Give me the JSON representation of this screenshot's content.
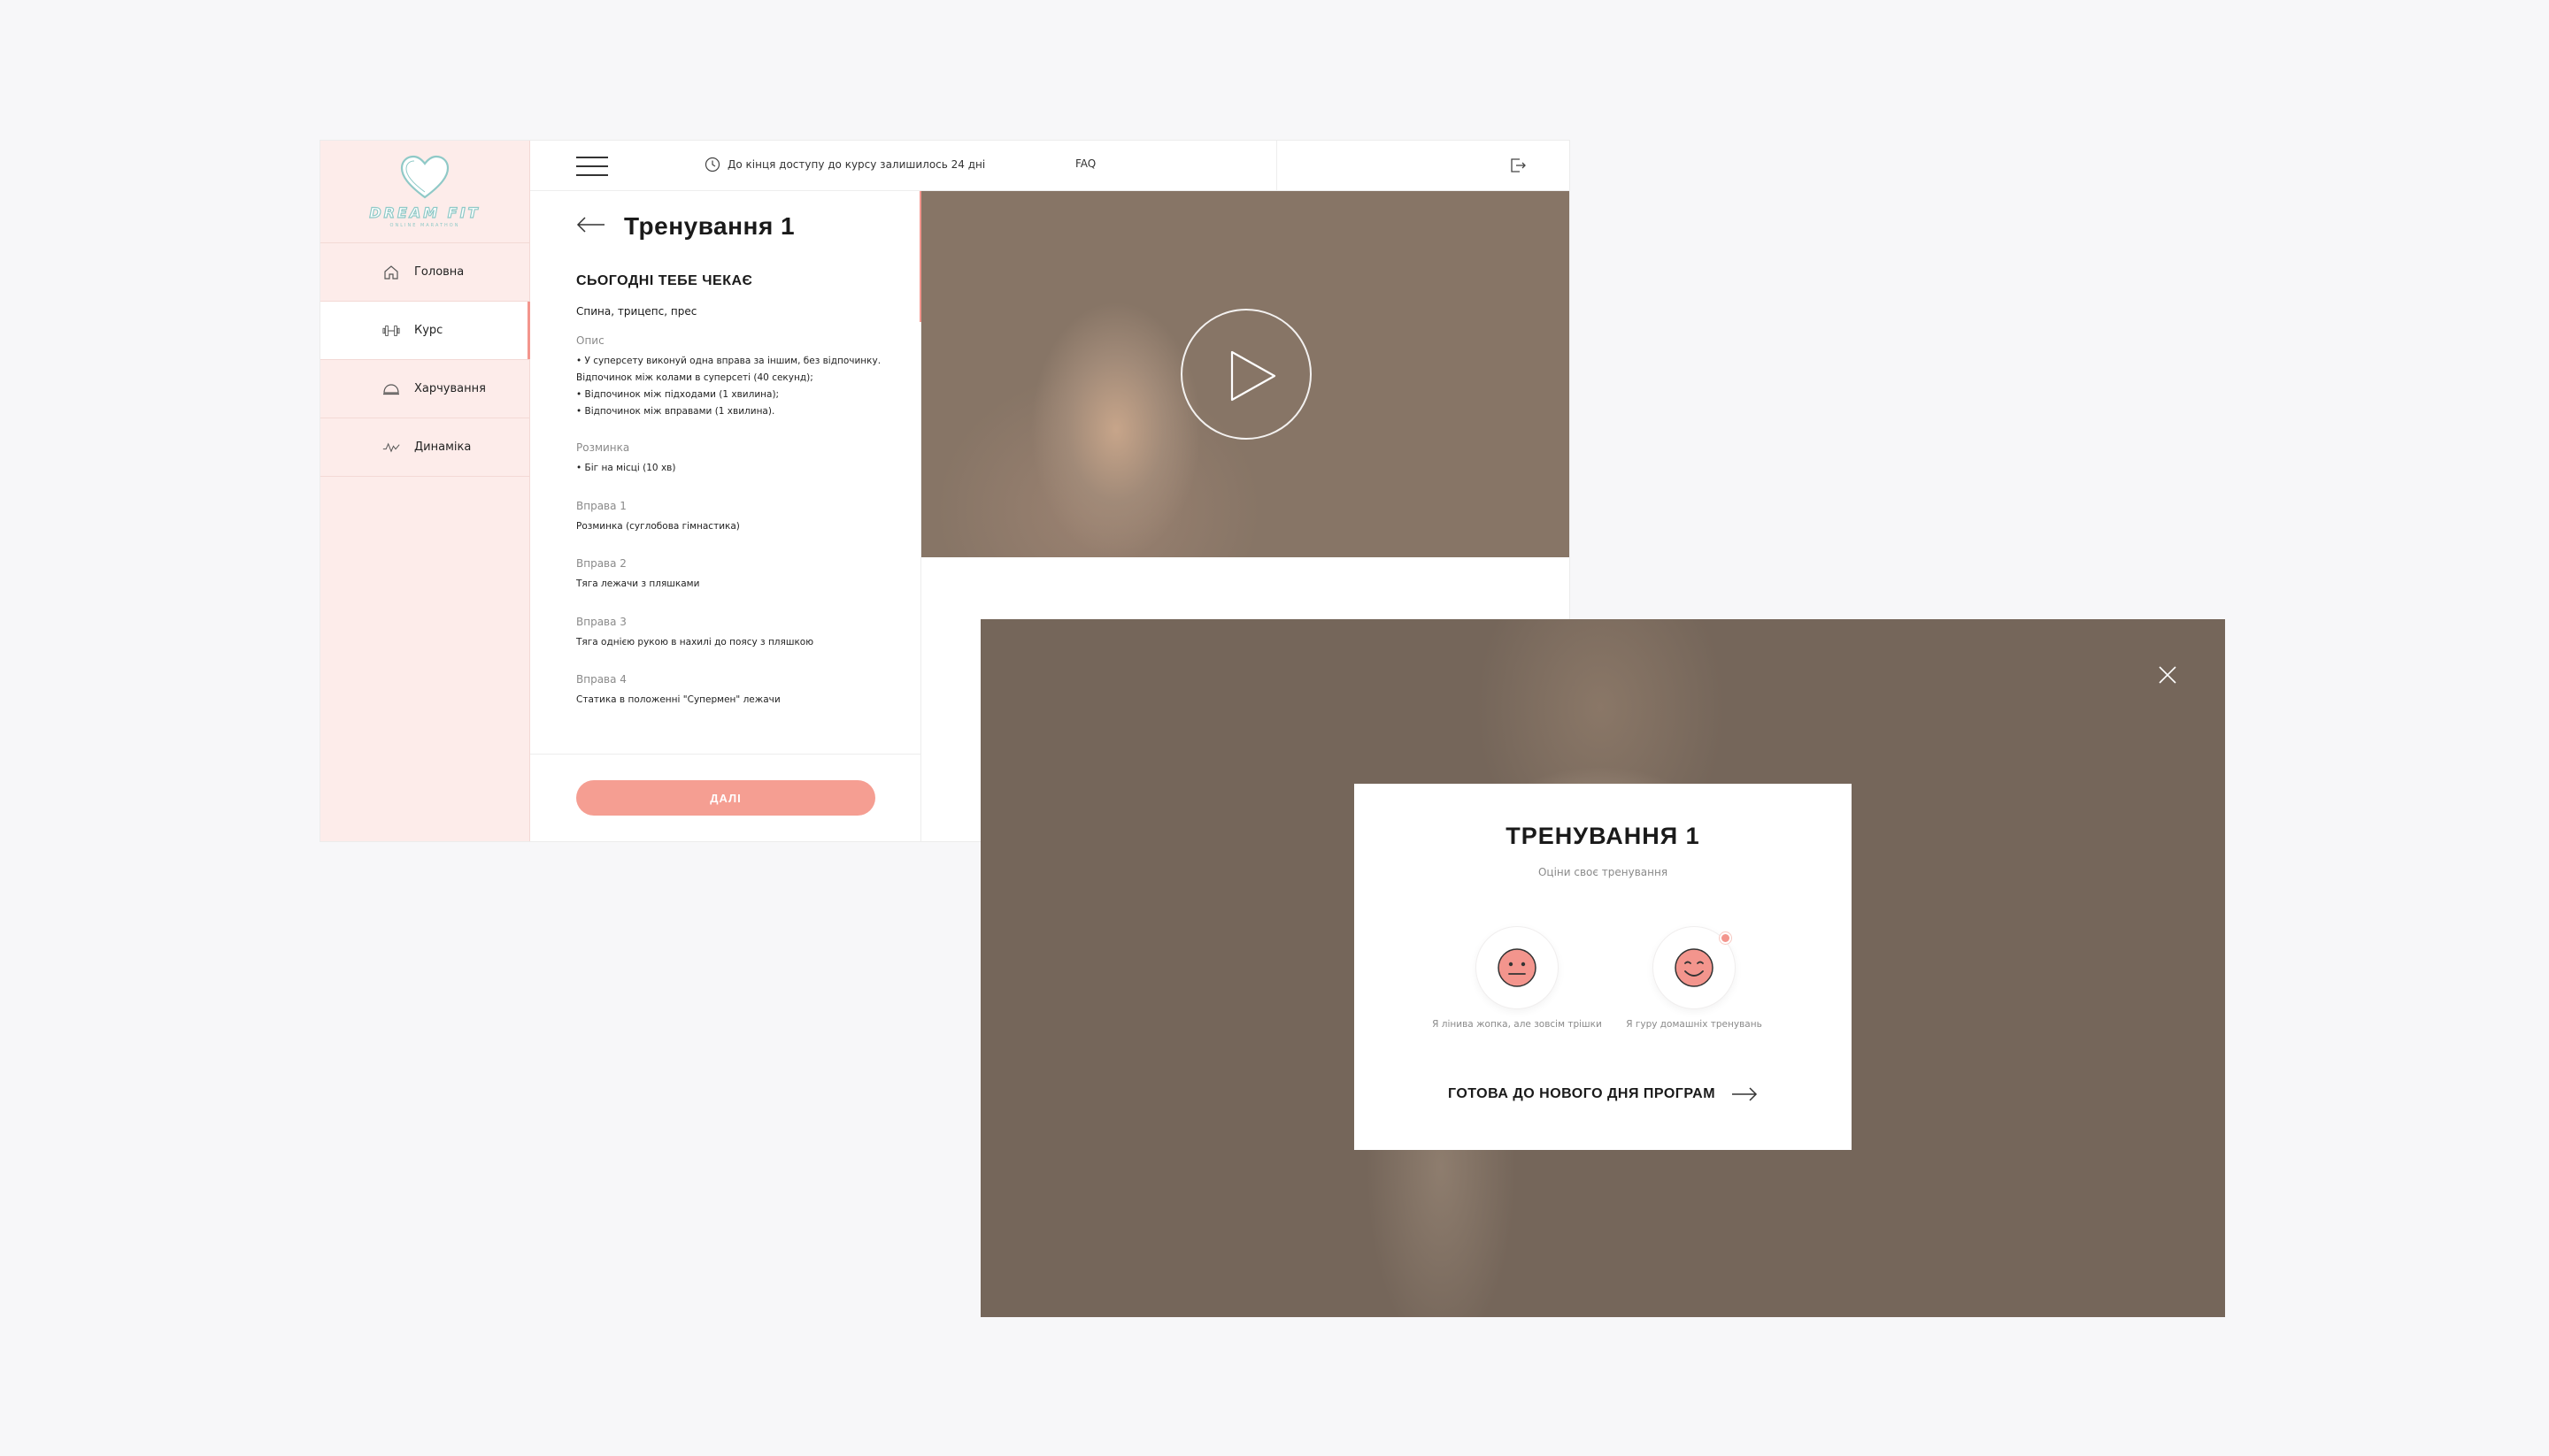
{
  "brand": {
    "name": "DREAM FIT",
    "tagline": "ONLINE MARATHON"
  },
  "sidebar": {
    "items": [
      {
        "label": "Головна",
        "icon": "home-icon",
        "active": false
      },
      {
        "label": "Курс",
        "icon": "dumbbell-icon",
        "active": true
      },
      {
        "label": "Харчування",
        "icon": "food-cloche-icon",
        "active": false
      },
      {
        "label": "Динаміка",
        "icon": "activity-icon",
        "active": false
      }
    ]
  },
  "topbar": {
    "access_text": "До кінця доступу до курсу залишилось 24 дні",
    "faq": "FAQ"
  },
  "workout": {
    "title": "Тренування 1",
    "today_heading": "СЬОГОДНІ ТЕБЕ ЧЕКАЄ",
    "muscles": "Спина, трицепс, прес",
    "description_label": "Опис",
    "description": [
      "• У суперсету виконуй одна вправа за іншим, без відпочинку.",
      "Відпочинок між колами в суперсеті (40 секунд);",
      "• Відпочинок між підходами (1 хвилина);",
      "• Відпочинок між вправами (1 хвилина)."
    ],
    "warmup_label": "Розминка",
    "warmup": "• Біг на місці (10 хв)",
    "exercises": [
      {
        "label": "Вправа 1",
        "text": "Розминка (суглобова гімнастика)"
      },
      {
        "label": "Вправа 2",
        "text": "Тяга лежачи з пляшками"
      },
      {
        "label": "Вправа 3",
        "text": "Тяга однією рукою в нахилі до поясу з пляшкою"
      },
      {
        "label": "Вправа 4",
        "text": "Статика в положенні \"Супермен\" лежачи"
      }
    ],
    "next_button": "ДАЛІ"
  },
  "modal": {
    "title": "ТРЕНУВАННЯ 1",
    "subtitle": "Оціни своє тренування",
    "ratings": [
      {
        "label": "Я лінива жопка, але зовсім трішки",
        "icon": "neutral-face-icon",
        "selected": false
      },
      {
        "label": "Я гуру домашніх тренувань",
        "icon": "smile-face-icon",
        "selected": true
      }
    ],
    "cta": "ГОТОВА ДО НОВОГО ДНЯ ПРОГРАМ"
  },
  "colors": {
    "accent": "#f3958d",
    "sidebar_bg": "#fdecea",
    "button": "#f59e92",
    "logo": "#8fc9c7"
  }
}
